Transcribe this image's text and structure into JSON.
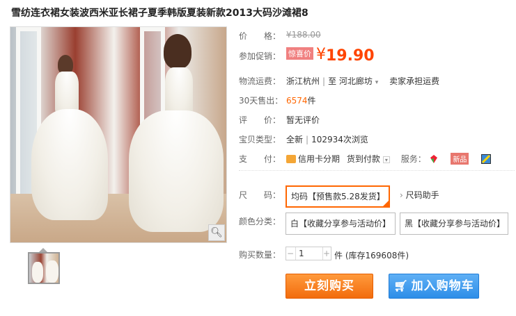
{
  "title": "雪纺连衣裙女装波西米亚长裙子夏季韩版夏装新款2013大码沙滩裙8",
  "price": {
    "label": "价　　格：",
    "value": "¥188.00"
  },
  "promo": {
    "label": "参加促销：",
    "tag": "惊喜价",
    "currency": "¥",
    "value": "19.90"
  },
  "shipping": {
    "label": "物流运费：",
    "from": "浙江杭州",
    "sep": "|",
    "to_prefix": "至",
    "to": "河北廊坊",
    "fee": "卖家承担运费"
  },
  "sold": {
    "label": "30天售出：",
    "count": "6574",
    "unit": "件"
  },
  "review": {
    "label": "评　　价：",
    "value": "暂无评价"
  },
  "type": {
    "label": "宝贝类型：",
    "condition": "全新",
    "sep": "|",
    "views": "102934次浏览"
  },
  "payment": {
    "label": "支　　付：",
    "method1": "信用卡分期",
    "method2": "货到付款",
    "service_label": "服务：",
    "badge": "新品"
  },
  "size": {
    "label": "尺　　码：",
    "selected": "均码【预售款5.28发货】",
    "helper": "尺码助手"
  },
  "color": {
    "label": "颜色分类：",
    "options": [
      "白【收藏分享参与活动价】",
      "黑【收藏分享参与活动价】"
    ]
  },
  "quantity": {
    "label": "购买数量：",
    "value": "1",
    "unit": "件",
    "stock": "(库存169608件)"
  },
  "buttons": {
    "buy": "立刻购买",
    "cart": "加入购物车"
  },
  "icons": {
    "zoom": "magnifier-icon",
    "cart": "cart-icon",
    "card": "credit-card-icon"
  },
  "colors": {
    "accent": "#f40",
    "buy": "#f26c0d",
    "cart": "#2d8ee8"
  }
}
